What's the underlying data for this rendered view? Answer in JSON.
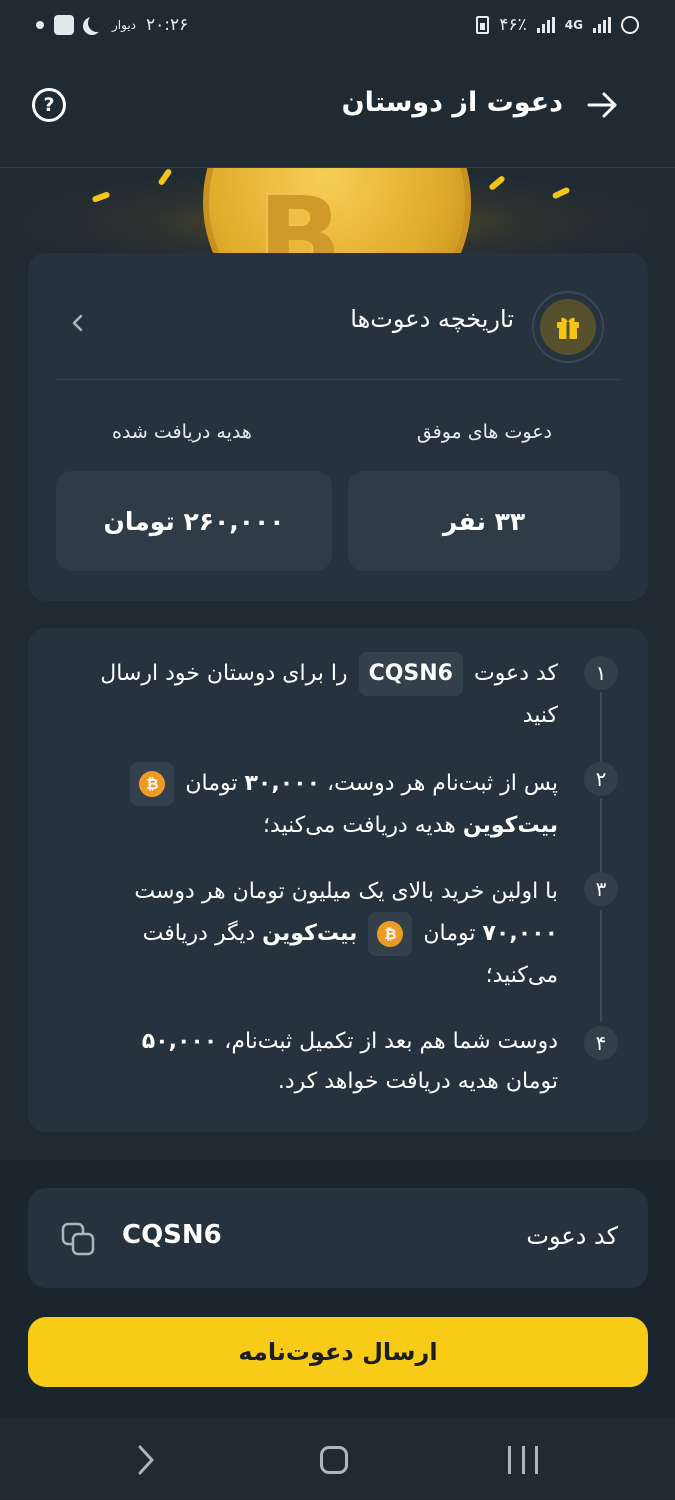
{
  "status_bar": {
    "time": "۲۰:۲۶",
    "app_label": "دیوار",
    "battery": "۴۶٪",
    "network": "4G"
  },
  "header": {
    "title": "دعوت از دوستان",
    "help_symbol": "?"
  },
  "hero": {
    "coin_symbol": "B"
  },
  "history": {
    "label": "تاریخچه دعوت‌ها"
  },
  "stats": {
    "successful_label": "دعوت های موفق",
    "successful_value": "۳۳ نفر",
    "gift_label": "هدیه دریافت شده",
    "gift_value": "۲۶۰,۰۰۰ تومان"
  },
  "steps": [
    {
      "number": "۱",
      "pre": "کد دعوت",
      "code": "CQSN6",
      "post": "را برای دوستان خود ارسال کنید"
    },
    {
      "number": "۲",
      "pre": "پس از ثبت‌نام هر دوست،",
      "amount": "۳۰,۰۰۰",
      "mid": "تومان",
      "coin": "بیت‌کوین",
      "post": "هدیه دریافت می‌کنید؛"
    },
    {
      "number": "۳",
      "pre": "با اولین خرید بالای یک میلیون تومان هر دوست",
      "amount": "۷۰,۰۰۰",
      "mid": "تومان",
      "coin": "بیت‌کوین",
      "post": "دیگر دریافت می‌کنید؛"
    },
    {
      "number": "۴",
      "pre": "دوست شما هم بعد از تکمیل ثبت‌نام،",
      "amount": "۵۰,۰۰۰",
      "post": "تومان هدیه دریافت خواهد کرد."
    }
  ],
  "invite_code": {
    "label": "کد دعوت",
    "value": "CQSN6"
  },
  "send_button": {
    "label": "ارسال دعوت‌نامه"
  },
  "colors": {
    "background": "#1f2a33",
    "card": "#26323d",
    "accent": "#f8cc16",
    "bitcoin": "#f09a26"
  }
}
